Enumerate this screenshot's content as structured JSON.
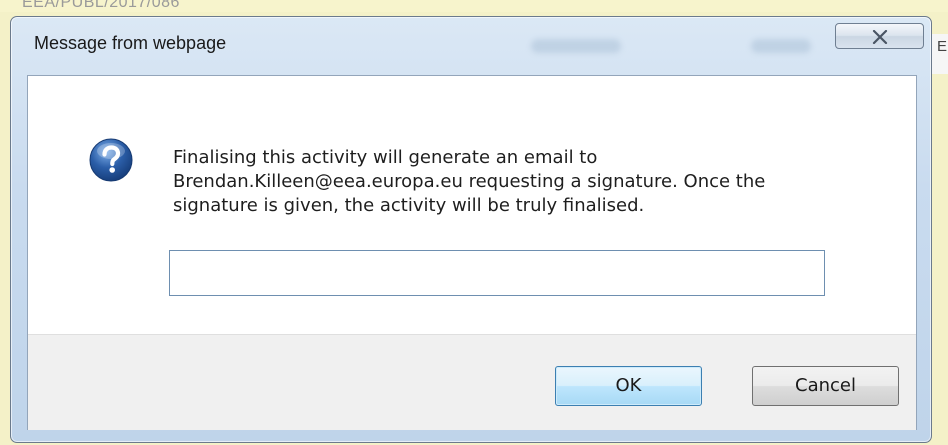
{
  "background": {
    "fragment_text": "EEA/PUBL/2017/086",
    "right_edge_text": "E"
  },
  "dialog": {
    "title": "Message from webpage",
    "close_label": "Close",
    "icon": "question-icon",
    "message_lines": [
      "Finalising this activity will generate an email to",
      "Brendan.Killeen@eea.europa.eu requesting a signature. Once the",
      "signature is given, the activity will be truly finalised."
    ],
    "input": {
      "value": "",
      "placeholder": ""
    },
    "buttons": {
      "ok": "OK",
      "cancel": "Cancel"
    }
  },
  "colors": {
    "page_background": "#f4f1c8",
    "titlebar": "#c9dbef",
    "ok_border": "#3c7fb1",
    "icon_blue": "#2b5ea8"
  }
}
